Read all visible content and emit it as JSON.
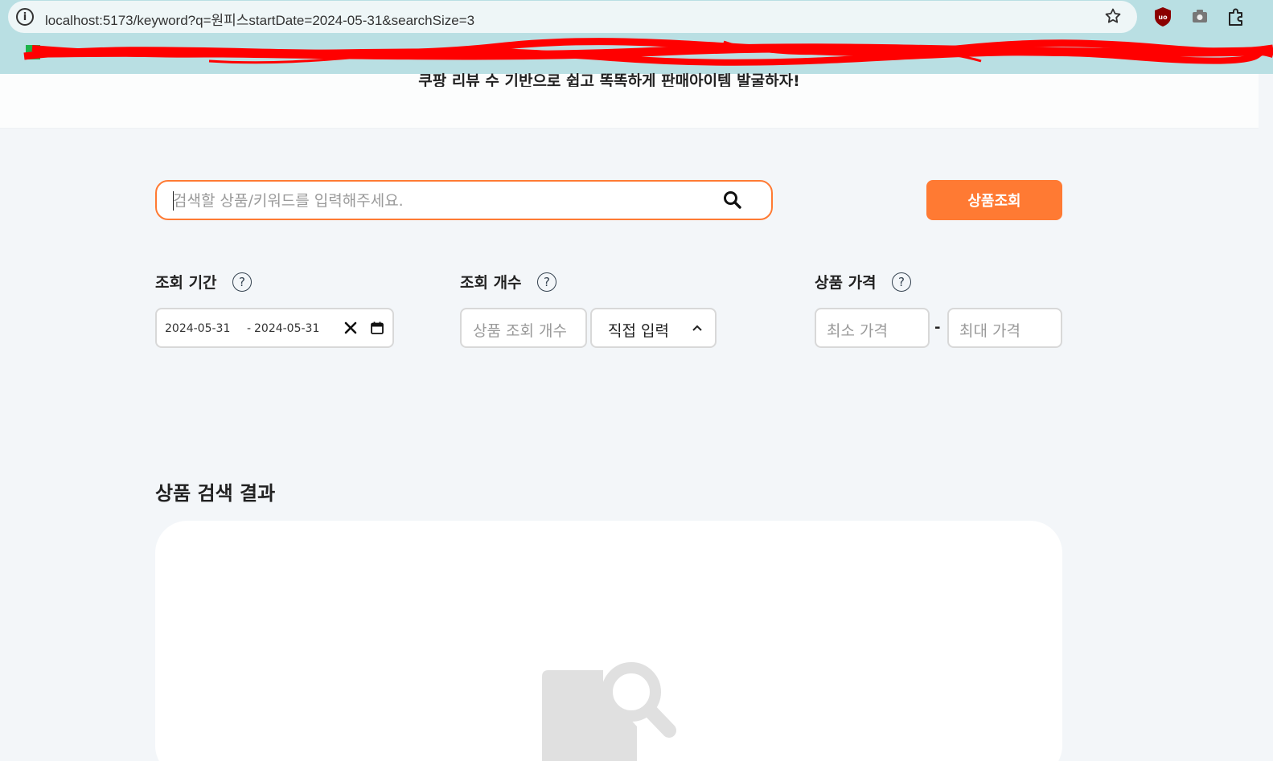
{
  "browser": {
    "url": "localhost:5173/keyword?q=원피스startDate=2024-05-31&searchSize=3"
  },
  "header": {
    "tagline": "쿠팡 리뷰 수 기반으로 쉽고 똑똑하게 판매아이템 발굴하자!"
  },
  "search": {
    "placeholder": "검색할 상품/키워드를 입력해주세요.",
    "value": "",
    "submit_label": "상품조회"
  },
  "filters": {
    "period": {
      "label": "조회 기간",
      "start": "2024-05-31",
      "end": "2024-05-31",
      "separator": "-"
    },
    "count": {
      "label": "조회 개수",
      "placeholder": "상품 조회 개수",
      "mode": "직접 입력"
    },
    "price": {
      "label": "상품 가격",
      "min_placeholder": "최소 가격",
      "max_placeholder": "최대 가격",
      "separator": "-"
    },
    "help_glyph": "?"
  },
  "results": {
    "title": "상품 검색 결과"
  },
  "colors": {
    "accent": "#ff7a33",
    "page_bg": "#f3f6f9",
    "chrome_bg": "#b9dfe3",
    "empty_icon": "#e0e0e0"
  },
  "icons": {
    "info": "info-icon",
    "star": "star-icon",
    "search": "search-icon",
    "clear": "close-icon",
    "calendar": "calendar-icon",
    "chevron": "chevron-up-icon",
    "empty": "document-search-icon"
  }
}
